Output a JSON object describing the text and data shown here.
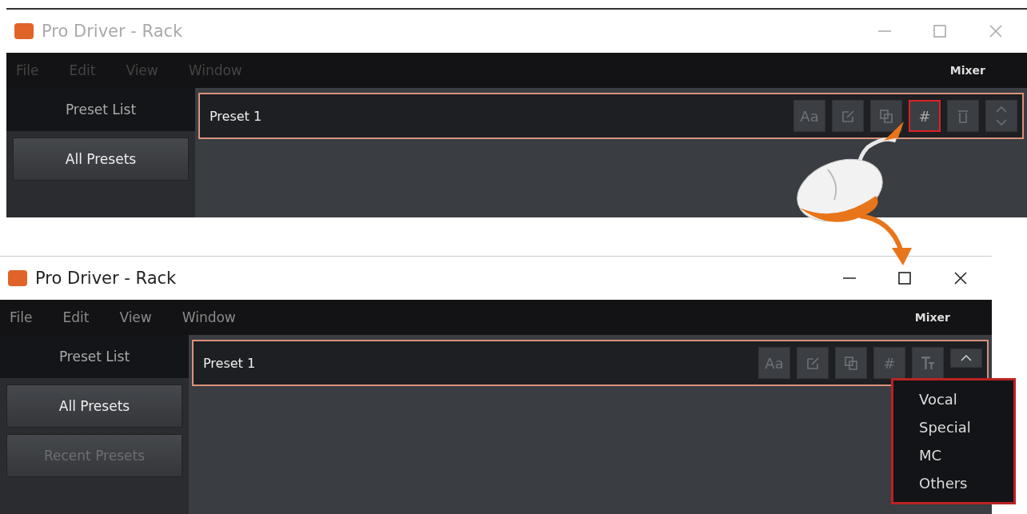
{
  "windows": [
    {
      "title": "Pro Driver - Rack",
      "faded": true,
      "menu": [
        "File",
        "Edit",
        "View",
        "Window"
      ],
      "mixer": "Mixer",
      "sidebar": {
        "header": "Preset List",
        "items": [
          {
            "label": "All Presets",
            "disabled": false
          }
        ]
      },
      "preset": {
        "name": "Preset 1"
      },
      "toolbar": [
        {
          "kind": "label",
          "label": "Aa",
          "highlighted": false
        },
        {
          "kind": "pencil",
          "highlighted": false
        },
        {
          "kind": "copy",
          "highlighted": false
        },
        {
          "kind": "label",
          "label": "#",
          "highlighted": true
        },
        {
          "kind": "trash",
          "highlighted": false
        },
        {
          "kind": "updown",
          "highlighted": false
        }
      ]
    },
    {
      "title": "Pro Driver - Rack",
      "faded": false,
      "menu": [
        "File",
        "Edit",
        "View",
        "Window"
      ],
      "mixer": "Mixer",
      "sidebar": {
        "header": "Preset List",
        "items": [
          {
            "label": "All Presets",
            "disabled": false
          },
          {
            "label": "Recent Presets",
            "disabled": true
          }
        ]
      },
      "preset": {
        "name": "Preset 1"
      },
      "toolbar": [
        {
          "kind": "label",
          "label": "Aa",
          "highlighted": false
        },
        {
          "kind": "pencil",
          "highlighted": false
        },
        {
          "kind": "copy",
          "highlighted": false
        },
        {
          "kind": "label",
          "label": "#",
          "highlighted": false
        },
        {
          "kind": "text",
          "highlighted": false
        },
        {
          "kind": "up",
          "highlighted": false
        }
      ],
      "dropdown": [
        "Vocal",
        "Special",
        "MC",
        "Others"
      ]
    }
  ]
}
